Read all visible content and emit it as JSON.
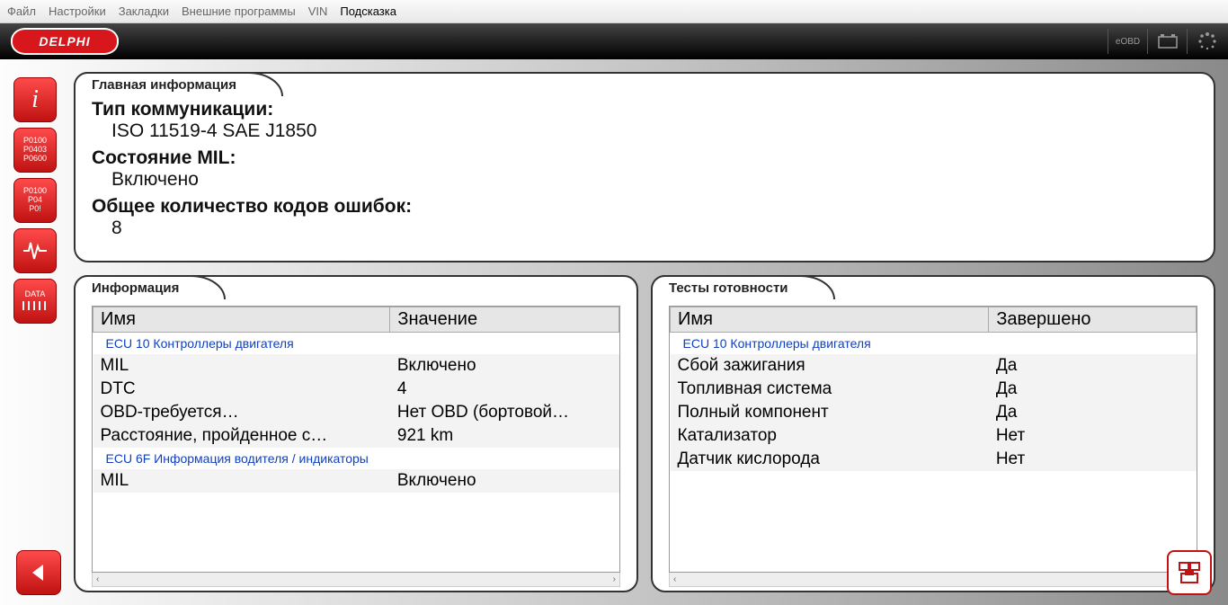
{
  "menu": {
    "items": [
      "Файл",
      "Настройки",
      "Закладки",
      "Внешние программы",
      "VIN",
      "Подсказка"
    ]
  },
  "logo": "DELPHI",
  "topbar": {
    "eobd": "eOBD"
  },
  "panels": {
    "main_info": {
      "title": "Главная информация",
      "rows": [
        {
          "label": "Тип коммуникации:",
          "value": "ISO 11519-4 SAE J1850"
        },
        {
          "label": "Состояние MIL:",
          "value": "Включено"
        },
        {
          "label": "Общее количество кодов ошибок:",
          "value": "8"
        }
      ]
    },
    "info": {
      "title": "Информация",
      "headers": [
        "Имя",
        "Значение"
      ],
      "groups": [
        {
          "name": "ECU 10 Контроллеры двигателя",
          "rows": [
            {
              "name": "MIL",
              "value": "Включено"
            },
            {
              "name": "DTC",
              "value": "4"
            },
            {
              "name": "OBD-требуется…",
              "value": "Нет OBD (бортовой…"
            },
            {
              "name": "Расстояние, пройденное с…",
              "value": "921 km"
            }
          ]
        },
        {
          "name": "ECU 6F Информация водителя / индикаторы",
          "rows": [
            {
              "name": "MIL",
              "value": "Включено"
            }
          ]
        }
      ]
    },
    "readiness": {
      "title": "Тесты готовности",
      "headers": [
        "Имя",
        "Завершено"
      ],
      "groups": [
        {
          "name": "ECU 10 Контроллеры двигателя",
          "rows": [
            {
              "name": "Сбой зажигания",
              "value": "Да"
            },
            {
              "name": "Топливная система",
              "value": "Да"
            },
            {
              "name": "Полный компонент",
              "value": "Да"
            },
            {
              "name": "Катализатор",
              "value": "Нет"
            },
            {
              "name": "Датчик кислорода",
              "value": "Нет"
            }
          ]
        }
      ]
    }
  },
  "sidebar": {
    "items": [
      {
        "id": "info",
        "label": "i"
      },
      {
        "id": "codes1",
        "label": "P0100\nP0403\nP0600"
      },
      {
        "id": "codes2",
        "label": "P0100\nP04\nP0!"
      },
      {
        "id": "live",
        "label": ""
      },
      {
        "id": "data",
        "label": "DATA"
      }
    ]
  }
}
